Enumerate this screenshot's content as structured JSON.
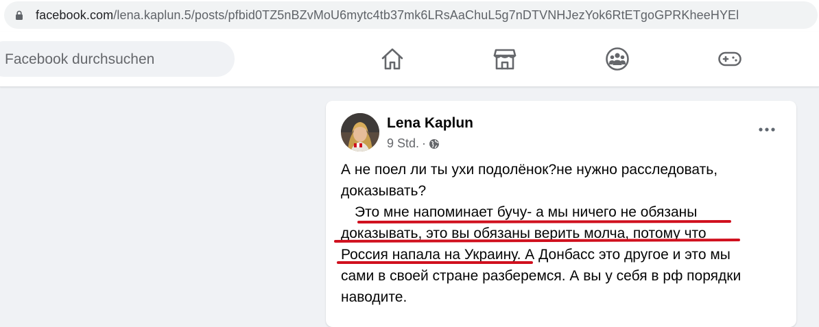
{
  "browser": {
    "url_host": "facebook.com",
    "url_path": "/lena.kaplun.5/posts/pfbid0TZ5nBZvMoU6mytc4tb37mk6LRsAaChuL5g7nDTVNHJezYok6RtETgoGPRKheeHYEl"
  },
  "header": {
    "search_placeholder": "Facebook durchsuchen",
    "nav_icons": [
      "home-icon",
      "marketplace-icon",
      "groups-icon",
      "gaming-icon"
    ]
  },
  "post": {
    "author": "Lena Kaplun",
    "time": "9 Std.",
    "separator": "·",
    "audience_icon": "globe-icon",
    "lines": [
      "А не поел ли ты ухи подолёнок?не нужно расследовать,",
      "доказывать?",
      "Это мне напоминает бучу- а мы ничего не обязаны",
      "доказывать, это вы обязаны верить молча, потому что",
      "Россия напала на Украину. А Донбасс это другое и это мы",
      "сами в своей стране разберемся. А вы у себя в рф порядки",
      "наводите."
    ]
  },
  "colors": {
    "underline": "#d0101e",
    "page_bg": "#f0f2f5",
    "text": "#050505",
    "secondary_text": "#65676b"
  }
}
